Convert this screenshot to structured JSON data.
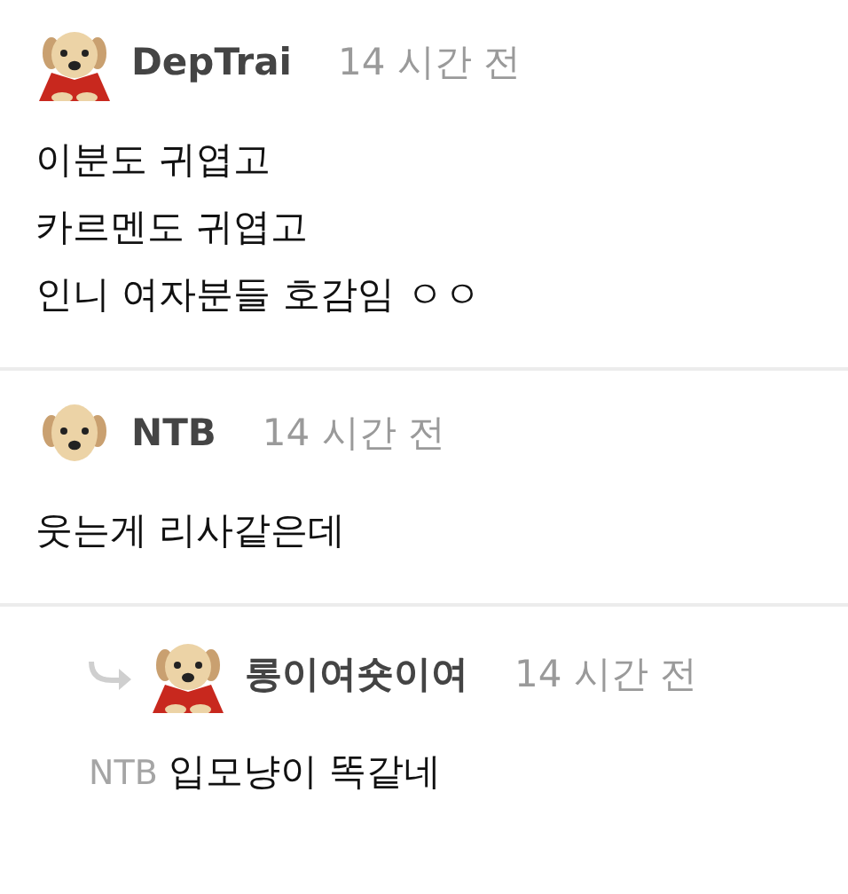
{
  "comments": [
    {
      "kind": "comment",
      "author": "DepTrai",
      "caped": true,
      "time": "14 시간 전",
      "lines": [
        "이분도 귀엽고",
        "카르멘도 귀엽고",
        "인니 여자분들 호감임 ㅇㅇ"
      ]
    },
    {
      "kind": "comment",
      "author": "NTB",
      "caped": false,
      "time": "14 시간 전",
      "lines": [
        "웃는게 리사같은데"
      ]
    },
    {
      "kind": "reply",
      "author": "롱이여숏이여",
      "caped": true,
      "time": "14 시간 전",
      "mention": "NTB",
      "lines": [
        "입모냥이 똑같네"
      ]
    }
  ]
}
